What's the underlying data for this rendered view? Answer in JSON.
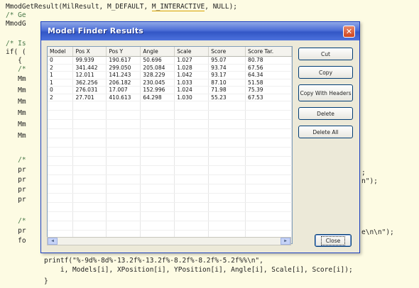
{
  "code": {
    "line1_pre": "MmodGetResult(MilResult, M_DEFAULT, ",
    "line1_ul": "M_INTERACTIVE",
    "line1_post": ", NULL);",
    "line2": "/* Ge",
    "line3": "MmodG",
    "line4": "/* Is",
    "line5": "if( (",
    "line6": "   {",
    "line7": "   /*",
    "line8": "   Mm",
    "line9": "   Mm",
    "line10": "   Mm",
    "line11": "   Mm",
    "line12": "   Mm",
    "line13": "   Mm",
    "line14": "   /*",
    "line15": "   pr",
    "line16": "   pr",
    "line17": "   pr",
    "line18": "   pr",
    "line19": "   /*",
    "line20": "   pr",
    "line21": "   fo",
    "right1": ";",
    "right2": "n\");",
    "right3": "e\\n\\n\");",
    "line22": "printf(\"%-9d%-8d%-13.2f%-13.2f%-8.2f%-8.2f%-5.2f%%\\n\",",
    "line23": "    i, Models[i], XPosition[i], YPosition[i], Angle[i], Scale[i], Score[i]);",
    "line24": "}"
  },
  "dialog": {
    "title": "Model Finder Results",
    "close_glyph": "✕",
    "columns": [
      "Model",
      "Pos X",
      "Pos Y",
      "Angle",
      "Scale",
      "Score",
      "Score Tar."
    ],
    "rows": [
      [
        "0",
        "99.939",
        "190.617",
        "50.696",
        "1.027",
        "95.07",
        "80.78"
      ],
      [
        "2",
        "341.442",
        "299.050",
        "205.084",
        "1.028",
        "93.74",
        "67.56"
      ],
      [
        "1",
        "12.011",
        "141.243",
        "328.229",
        "1.042",
        "93.17",
        "64.34"
      ],
      [
        "1",
        "362.256",
        "206.182",
        "230.045",
        "1.033",
        "87.10",
        "51.58"
      ],
      [
        "0",
        "276.031",
        "17.007",
        "152.996",
        "1.024",
        "71.98",
        "75.39"
      ],
      [
        "2",
        "27.701",
        "410.613",
        "64.298",
        "1.030",
        "55.23",
        "67.53"
      ]
    ],
    "buttons": {
      "cut": "Cut",
      "copy": "Copy",
      "copy_with_headers": "Copy With Headers",
      "delete": "Delete",
      "delete_all": "Delete All",
      "close": "Close"
    },
    "scroll_left": "◀",
    "scroll_right": "▶"
  }
}
